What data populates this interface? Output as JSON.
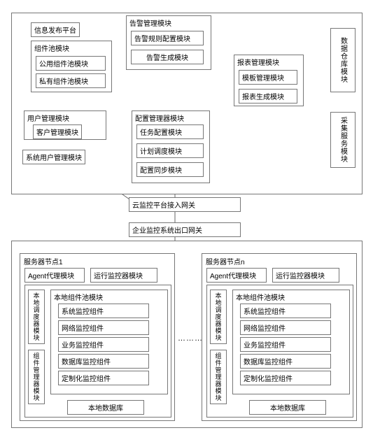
{
  "top": {
    "info_platform": "信息发布平台",
    "component_pool": {
      "title": "组件池模块",
      "public": "公用组件池模块",
      "private": "私有组件池模块"
    },
    "user_mgmt": {
      "title": "用户管理模块",
      "customer": "客户管理模块"
    },
    "sys_user_mgmt": "系统用户管理模块",
    "alarm": {
      "title": "告警管理模块",
      "rule": "告警规则配置模块",
      "gen": "告警生成模块"
    },
    "report": {
      "title": "报表管理模块",
      "template": "模板管理模块",
      "gen": "报表生成模块"
    },
    "config": {
      "title": "配置管理器模块",
      "task": "任务配置模块",
      "plan": "计划调度模块",
      "sync": "配置同步模块"
    },
    "warehouse": "数据仓库模块",
    "collect": "采集服务模块"
  },
  "mid": {
    "cloud_gw": "云监控平台接入网关",
    "ent_gw": "企业监控系统出口网关"
  },
  "server1": {
    "title": "服务器节点1",
    "agent": "Agent代理模块",
    "runmon": "运行监控器模块",
    "local_sched": "本地调度器模块",
    "comp_mgr": "组件管理器模块",
    "local_pool": {
      "title": "本地组件池模块",
      "sys": "系统监控组件",
      "net": "网络监控组件",
      "biz": "业务监控组件",
      "db": "数据库监控组件",
      "custom": "定制化监控组件"
    },
    "local_db": "本地数据库"
  },
  "serverN": {
    "title": "服务器节点n",
    "agent": "Agent代理模块",
    "runmon": "运行监控器模块",
    "local_sched": "本地调度器模块",
    "comp_mgr": "组件管理器模块",
    "local_pool": {
      "title": "本地组件池模块",
      "sys": "系统监控组件",
      "net": "网络监控组件",
      "biz": "业务监控组件",
      "db": "数据库监控组件",
      "custom": "定制化监控组件"
    },
    "local_db": "本地数据库"
  },
  "ellipsis": "…………"
}
